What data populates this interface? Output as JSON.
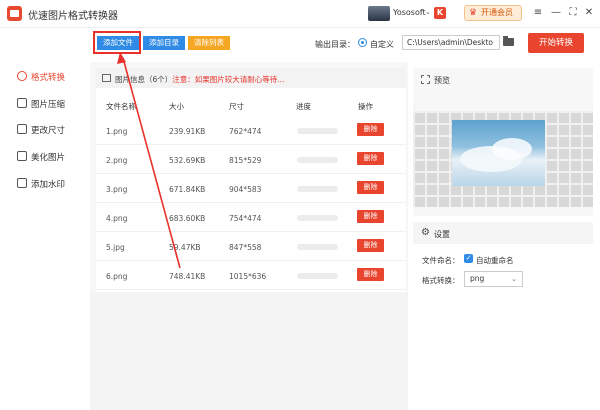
{
  "app": {
    "title": "优速图片格式转换器",
    "username": "Yososoft",
    "vip_label": "开通会员"
  },
  "window_controls": {
    "menu": "≡",
    "minimize": "—",
    "maximize": "⛶",
    "close": "✕"
  },
  "toolbar": {
    "add_file": "添加文件",
    "add_dir": "添加目录",
    "clear_list": "清除列表",
    "output_label": "输出目录：",
    "output_option": "自定义",
    "output_path": "C:\\Users\\admin\\Deskto",
    "start_button": "开始转换"
  },
  "sidebar": {
    "items": [
      {
        "label": "格式转换",
        "icon": "format-convert-icon",
        "active": true
      },
      {
        "label": "图片压缩",
        "icon": "compress-icon",
        "active": false
      },
      {
        "label": "更改尺寸",
        "icon": "resize-icon",
        "active": false
      },
      {
        "label": "美化图片",
        "icon": "beautify-icon",
        "active": false
      },
      {
        "label": "添加水印",
        "icon": "watermark-icon",
        "active": false
      }
    ]
  },
  "file_list": {
    "info_title": "图片信息",
    "info_count": "（6个）",
    "info_note": "注意：如果图片较大请耐心等待...",
    "columns": [
      "文件名称",
      "大小",
      "尺寸",
      "进度",
      "操作"
    ],
    "delete_label": "删除",
    "rows": [
      {
        "name": "1.png",
        "size": "239.91KB",
        "dims": "762*474"
      },
      {
        "name": "2.png",
        "size": "532.69KB",
        "dims": "815*529"
      },
      {
        "name": "3.png",
        "size": "671.84KB",
        "dims": "904*583"
      },
      {
        "name": "4.png",
        "size": "683.60KB",
        "dims": "754*474"
      },
      {
        "name": "5.jpg",
        "size": "59.47KB",
        "dims": "847*558"
      },
      {
        "name": "6.png",
        "size": "748.41KB",
        "dims": "1015*636"
      }
    ]
  },
  "preview": {
    "title": "预览"
  },
  "settings": {
    "title": "设置",
    "rename_label": "文件命名：",
    "rename_option": "自动重命名",
    "rename_checked": true,
    "format_label": "格式转换：",
    "format_value": "png"
  },
  "colors": {
    "accent_red": "#e8442e",
    "primary_blue": "#2f8be6",
    "clear_orange": "#f5a623"
  }
}
